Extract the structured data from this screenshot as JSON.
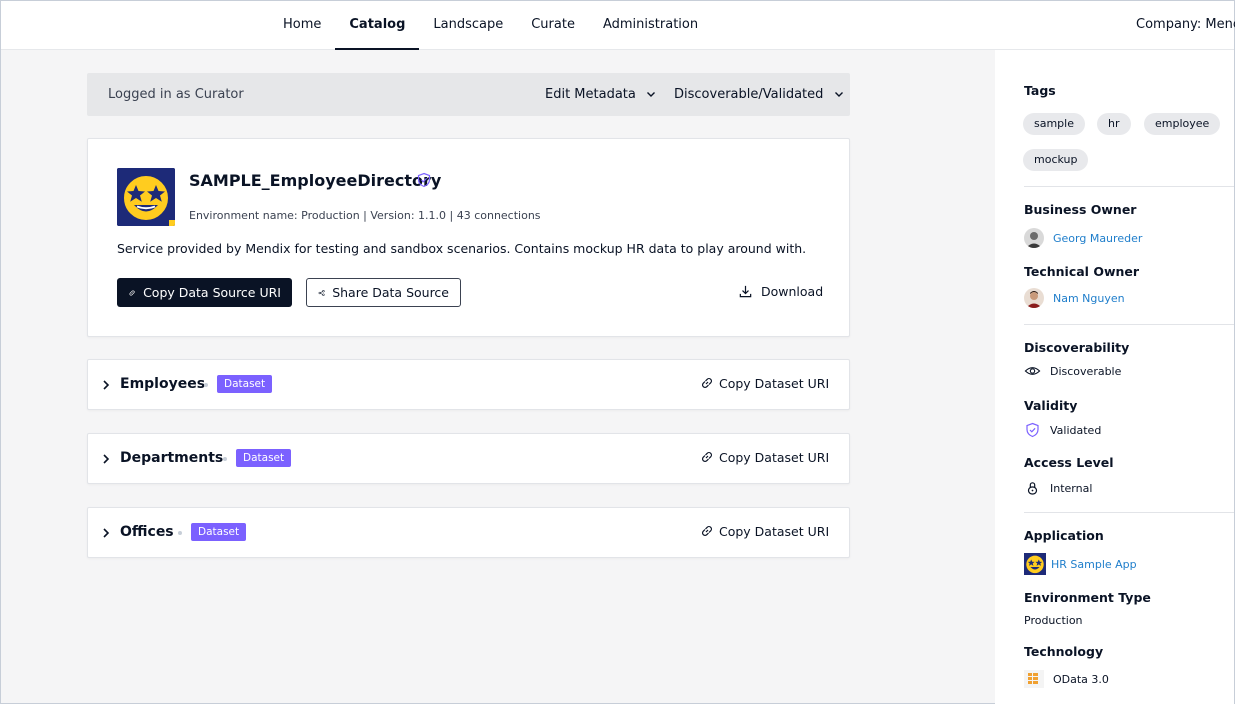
{
  "nav": {
    "items": [
      "Home",
      "Catalog",
      "Landscape",
      "Curate",
      "Administration"
    ],
    "active": "Catalog",
    "company_label": "Company:",
    "company_value": "Menc"
  },
  "curator_bar": {
    "logged_in": "Logged in as Curator",
    "edit_metadata": "Edit Metadata",
    "status_dropdown": "Discoverable/Validated"
  },
  "data_source": {
    "title": "SAMPLE_EmployeeDirectory",
    "environment_label": "Environment name:",
    "environment_value": "Production | Version: 1.1.0 | 43 connections",
    "description": "Service provided by Mendix for testing and sandbox scenarios. Contains mockup HR data to play around with.",
    "copy_button": "Copy Data Source URI",
    "share_button": "Share Data Source",
    "download": "Download"
  },
  "datasets": [
    {
      "name": "Employees",
      "badge": "Dataset",
      "action": "Copy Dataset URI"
    },
    {
      "name": "Departments",
      "badge": "Dataset",
      "action": "Copy Dataset URI"
    },
    {
      "name": "Offices",
      "badge": "Dataset",
      "action": "Copy Dataset URI"
    }
  ],
  "sidebar": {
    "tags_heading": "Tags",
    "tags": [
      "sample",
      "hr",
      "employee",
      "mockup"
    ],
    "business_owner_heading": "Business Owner",
    "business_owner": "Georg Maureder",
    "technical_owner_heading": "Technical Owner",
    "technical_owner": "Nam Nguyen",
    "discoverability_heading": "Discoverability",
    "discoverability": "Discoverable",
    "validity_heading": "Validity",
    "validity": "Validated",
    "access_heading": "Access Level",
    "access": "Internal",
    "application_heading": "Application",
    "application": "HR Sample App",
    "env_type_heading": "Environment Type",
    "env_type": "Production",
    "technology_heading": "Technology",
    "technology": "OData 3.0"
  },
  "colors": {
    "primary_dark": "#0a1325",
    "badge_purple": "#7b61ff",
    "link_blue": "#1f7ecb",
    "validated_purple": "#7b61ff",
    "app_logo_bg": "#1d2a78"
  },
  "icons": [
    "chevron-down-icon",
    "shield-check-icon",
    "link-icon",
    "share-icon",
    "download-icon",
    "chevron-right-icon",
    "eye-icon",
    "lock-icon",
    "odata-icon"
  ]
}
